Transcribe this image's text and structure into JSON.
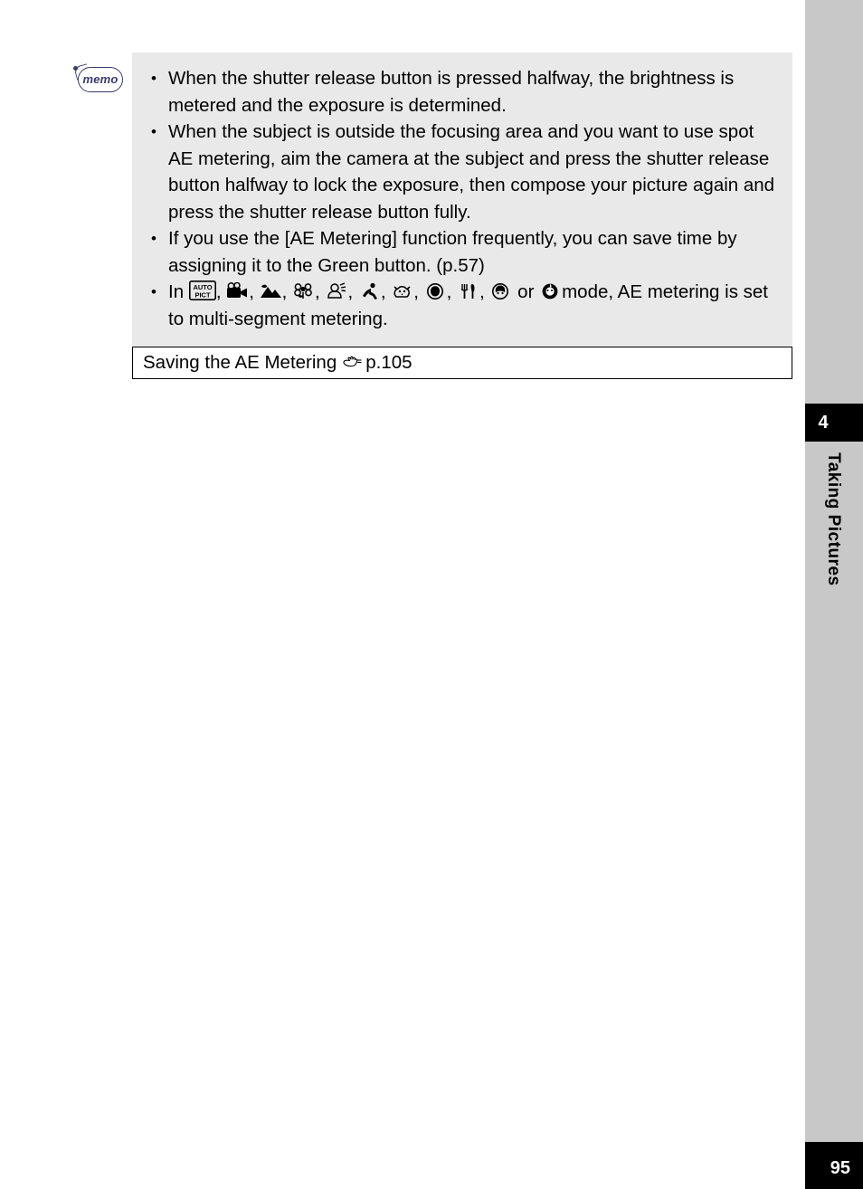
{
  "memo": {
    "icon_label": "memo",
    "bullets": [
      {
        "id": "bullet-shutter-halfway",
        "text": "When the shutter release button is pressed halfway, the brightness is metered and the exposure is determined."
      },
      {
        "id": "bullet-spot-ae",
        "text": "When the subject is outside the focusing area and you want to use spot AE metering, aim the camera at the subject and press the shutter release button halfway to lock the exposure, then compose your picture again and press the shutter release button fully."
      },
      {
        "id": "bullet-green-button",
        "text": "If you use the [AE Metering] function frequently, you can save time by assigning it to the Green button. (p.57)"
      },
      {
        "id": "bullet-modes",
        "prefix": "In",
        "mode_icons": [
          "auto-picture-mode-icon",
          "movie-mode-icon",
          "landscape-mode-icon",
          "flower-mode-icon",
          "natural-skin-tone-mode-icon",
          "sport-mode-icon",
          "pet-mode-icon",
          "portrait-mode-icon",
          "food-mode-icon",
          "kids-mode-icon",
          "frame-composite-mode-icon"
        ],
        "separator": ",",
        "conjunction": "or",
        "suffix": "mode, AE metering is set to multi-segment metering."
      }
    ]
  },
  "reference": {
    "text": "Saving the AE Metering",
    "icon": "pointing-hand-icon",
    "page_ref": "p.105"
  },
  "side_rail": {
    "chapter_number": "4",
    "chapter_title": "Taking Pictures",
    "page_number": "95"
  },
  "colors": {
    "memo_background": "#e9e9e9",
    "rail_background": "#c8c8c8",
    "tab_background": "#000000",
    "memo_icon_stroke": "#3a3a6e"
  }
}
